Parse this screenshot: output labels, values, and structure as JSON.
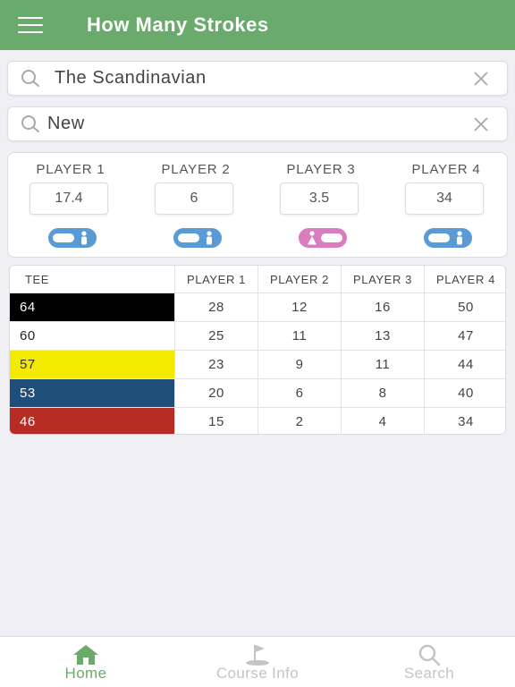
{
  "header": {
    "title": "How Many Strokes"
  },
  "search": {
    "course_value": "The Scandinavian",
    "tee_value": "New"
  },
  "players": [
    {
      "label": "PLAYER 1",
      "handicap": "17.4",
      "gender": "male"
    },
    {
      "label": "PLAYER 2",
      "handicap": "6",
      "gender": "male"
    },
    {
      "label": "PLAYER 3",
      "handicap": "3.5",
      "gender": "female"
    },
    {
      "label": "PLAYER 4",
      "handicap": "34",
      "gender": "male"
    }
  ],
  "table": {
    "headers": [
      "TEE",
      "PLAYER 1",
      "PLAYER 2",
      "PLAYER 3",
      "PLAYER 4"
    ],
    "rows": [
      {
        "tee": "64",
        "color": "#000000",
        "text_color": "#ffffff",
        "values": [
          "28",
          "12",
          "16",
          "50"
        ]
      },
      {
        "tee": "60",
        "color": "#ffffff",
        "text_color": "#222222",
        "values": [
          "25",
          "11",
          "13",
          "47"
        ]
      },
      {
        "tee": "57",
        "color": "#f2ea00",
        "text_color": "#333333",
        "values": [
          "23",
          "9",
          "11",
          "44"
        ]
      },
      {
        "tee": "53",
        "color": "#1f4e79",
        "text_color": "#ffffff",
        "values": [
          "20",
          "6",
          "8",
          "40"
        ]
      },
      {
        "tee": "46",
        "color": "#b62b24",
        "text_color": "#ffffff",
        "values": [
          "15",
          "2",
          "4",
          "34"
        ]
      }
    ]
  },
  "tabbar": {
    "home_label": "Home",
    "course_label": "Course Info",
    "search_label": "Search"
  },
  "colors": {
    "accent": "#6aaa6c",
    "male_toggle": "#5b9bd5",
    "female_toggle": "#d97cc0"
  }
}
